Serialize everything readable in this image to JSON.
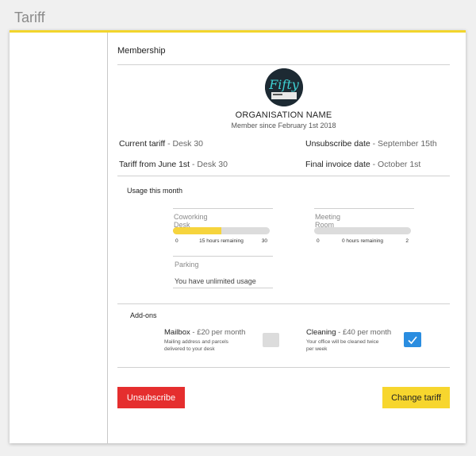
{
  "page": {
    "title": "Tariff"
  },
  "membership": {
    "section_label": "Membership",
    "org_name": "ORGANISATION NAME",
    "member_since": "Member since February 1st 2018",
    "logo_text": "Fifty"
  },
  "tariff": {
    "current_label": "Current tariff",
    "current_value": " - Desk 30",
    "from_label": "Tariff from June 1st",
    "from_value": " - Desk 30",
    "unsubscribe_label": "Unsubscribe date",
    "unsubscribe_value": " - September 15th",
    "final_invoice_label": "Final invoice date",
    "final_invoice_value": " - October 1st"
  },
  "usage": {
    "label": "Usage this month",
    "coworking": {
      "title": "Coworking Desk",
      "min": "0",
      "remaining": "15 hours remaining",
      "max": "30",
      "used_fraction": 0.5
    },
    "meeting": {
      "title": "Meeting Room",
      "min": "0",
      "remaining": "0 hours remaining",
      "max": "2",
      "used_fraction": 0
    },
    "parking": {
      "title": "Parking",
      "text": "You have unlimited usage"
    }
  },
  "addons": {
    "label": "Add-ons",
    "items": [
      {
        "name": "Mailbox",
        "price": " - £20 per month",
        "desc": "Mailing address and parcels delivered to your desk",
        "checked": false
      },
      {
        "name": "Cleaning",
        "price": " - £40 per month",
        "desc": "Your office will be cleaned twice per week",
        "checked": true
      }
    ]
  },
  "buttons": {
    "unsubscribe": "Unsubscribe",
    "change_tariff": "Change tariff"
  },
  "colors": {
    "accent_yellow": "#f7d62e",
    "danger_red": "#e52e2e",
    "check_blue": "#2a8de0"
  }
}
